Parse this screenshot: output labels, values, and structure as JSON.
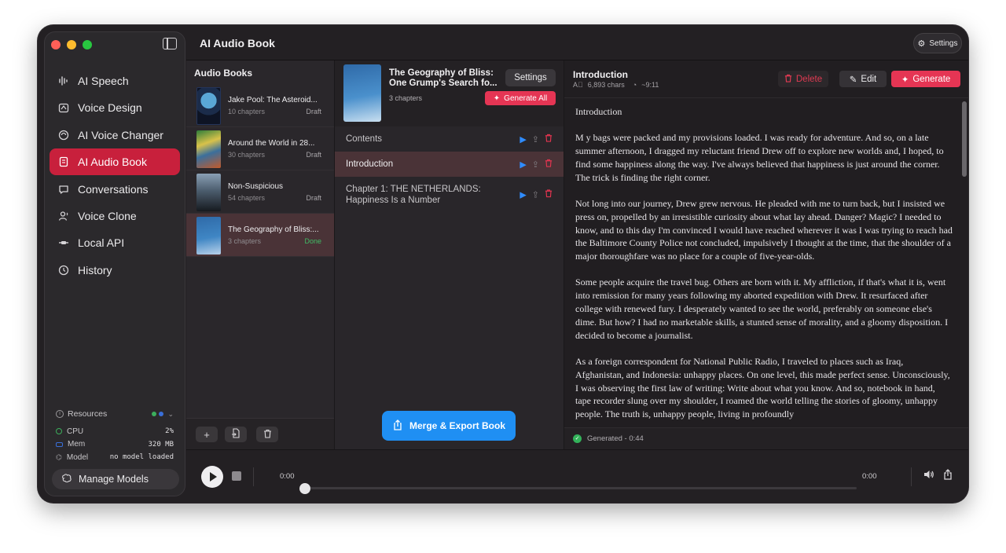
{
  "app": {
    "title": "AI Audio Book",
    "settings_label": "Settings"
  },
  "sidebar": {
    "items": [
      {
        "label": "AI Speech",
        "icon": "waveform-icon"
      },
      {
        "label": "Voice Design",
        "icon": "voice-design-icon"
      },
      {
        "label": "AI Voice Changer",
        "icon": "voice-changer-icon"
      },
      {
        "label": "AI Audio Book",
        "icon": "book-icon",
        "active": true
      },
      {
        "label": "Conversations",
        "icon": "chat-bubble-icon"
      },
      {
        "label": "Voice Clone",
        "icon": "person-voice-icon"
      },
      {
        "label": "Local API",
        "icon": "api-icon"
      },
      {
        "label": "History",
        "icon": "clock-icon"
      }
    ],
    "resources": {
      "label": "Resources",
      "cpu_label": "CPU",
      "cpu_value": "2%",
      "mem_label": "Mem",
      "mem_value": "320 MB",
      "model_label": "Model",
      "model_value": "no model loaded"
    },
    "manage_models_label": "Manage Models"
  },
  "books": {
    "header": "Audio Books",
    "items": [
      {
        "title": "Jake Pool: The Asteroid...",
        "chapters": "10 chapters",
        "status": "Draft"
      },
      {
        "title": "Around the World in 28...",
        "chapters": "30 chapters",
        "status": "Draft"
      },
      {
        "title": "Non-Suspicious",
        "chapters": "54 chapters",
        "status": "Draft"
      },
      {
        "title": "The Geography of Bliss:...",
        "chapters": "3 chapters",
        "status": "Done"
      }
    ]
  },
  "selected_book": {
    "title_line1": "The Geography of Bliss:",
    "title_line2": "One Grump's Search fo...",
    "chapters": "3 chapters",
    "settings_label": "Settings",
    "generate_all_label": "Generate All",
    "chapters_list": [
      {
        "label": "Contents"
      },
      {
        "label": "Introduction"
      },
      {
        "label_line1": "Chapter 1: THE NETHERLANDS:",
        "label_line2": "Happiness Is a Number"
      }
    ],
    "merge_label": "Merge & Export Book"
  },
  "chapter_view": {
    "title": "Introduction",
    "chars": "6,893 chars",
    "duration": "~9:11",
    "delete_label": "Delete",
    "edit_label": "Edit",
    "generate_label": "Generate",
    "paragraphs": [
      "Introduction",
      " M y bags were packed and my provisions loaded. I was ready for adventure. And so, on a late summer afternoon, I dragged my reluctant friend Drew off to explore new worlds and, I hoped, to find some happiness along the way. I've always believed that happiness is just around the corner. The trick is finding the right corner.",
      " Not long into our journey, Drew grew nervous. He pleaded with me to turn back, but I insisted we press on, propelled by an irresistible curiosity about what lay ahead. Danger? Magic? I needed to know, and to this day I'm convinced I would have reached wherever it was I was trying to reach had the Baltimore County Police not concluded, impulsively I thought at the time, that the shoulder of a major thoroughfare was no place for a couple of five-year-olds.",
      " Some people acquire the travel bug. Others are born with it. My affliction, if that's what it is, went into remission for many years following my aborted expedition with Drew. It resurfaced after college with renewed fury. I desperately wanted to see the world, preferably on someone else's dime. But how? I had no marketable skills, a stunted sense of morality, and a gloomy disposition. I decided to become a journalist.",
      " As a foreign correspondent for National Public Radio, I traveled to places such as Iraq, Afghanistan, and Indonesia: unhappy places. On one level, this made perfect sense. Unconsciously, I was observing the first law of writing: Write about what you know. And so, notebook in hand, tape recorder slung over my shoulder, I roamed the world telling the stories of gloomy, unhappy people. The truth is, unhappy people, living in profoundly"
    ],
    "status": "Generated - 0:44"
  },
  "player": {
    "current_time": "0:00",
    "total_time": "0:00",
    "progress": 0
  },
  "colors": {
    "accent": "#e53554",
    "active_nav": "#c8203c",
    "merge_blue": "#1f8ff3",
    "done_green": "#3fbd66"
  }
}
